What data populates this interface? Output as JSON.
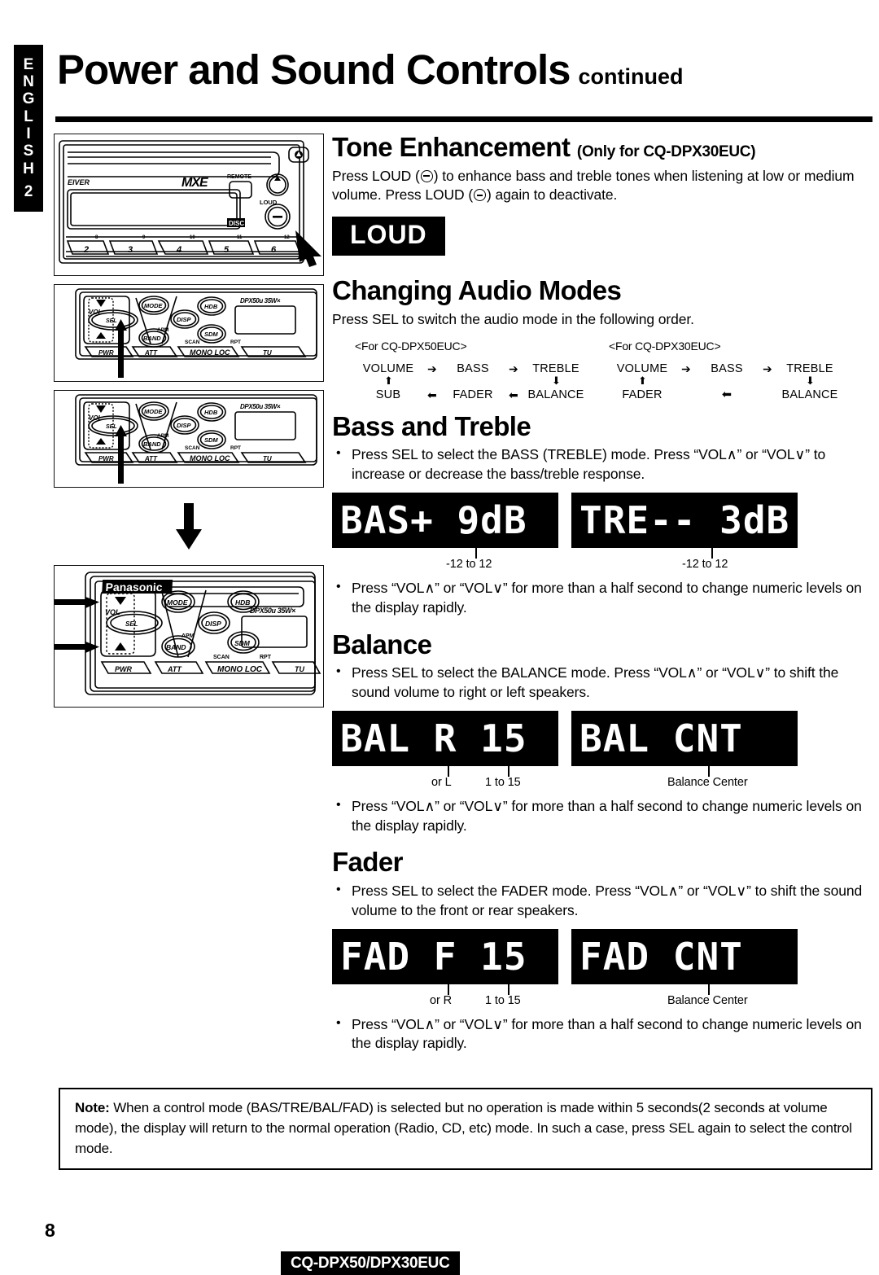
{
  "sidebar": {
    "language_letters": [
      "E",
      "N",
      "G",
      "L",
      "I",
      "S",
      "H"
    ],
    "section_number": "2"
  },
  "header": {
    "title": "Power and Sound Controls",
    "continued": "continued"
  },
  "sections": {
    "tone": {
      "heading": "Tone Enhancement",
      "qualifier": "(Only for CQ-DPX30EUC)",
      "body_part1": "Press LOUD (",
      "body_part2": ") to enhance bass and treble tones when listening at low or medium volume.  Press LOUD (",
      "body_part3": ") again to deactivate.",
      "badge_label": "LOUD"
    },
    "audio_modes": {
      "heading": "Changing Audio Modes",
      "intro": "Press SEL to switch the audio mode in the following order.",
      "groups": [
        {
          "header": "<For CQ-DPX50EUC>",
          "top_row": [
            "VOLUME",
            "BASS",
            "TREBLE"
          ],
          "bottom_row": [
            "SUB",
            "FADER",
            "BALANCE"
          ]
        },
        {
          "header": "<For CQ-DPX30EUC>",
          "top_row": [
            "VOLUME",
            "BASS",
            "TREBLE"
          ],
          "bottom_row": [
            "FADER",
            "",
            "BALANCE"
          ]
        }
      ]
    },
    "bass_treble": {
      "heading": "Bass and Treble",
      "bullet1": "Press SEL to select the BASS (TREBLE) mode.  Press “VOL∧” or “VOL∨” to increase or decrease the bass/treble response.",
      "lcd_left": "BAS+ 9dB",
      "lcd_right": "TRE-- 3dB",
      "callout_left": "-12 to 12",
      "callout_right": "-12 to 12",
      "bullet2": "Press “VOL∧” or “VOL∨” for more than a half second to change numeric levels on the display rapidly."
    },
    "balance": {
      "heading": "Balance",
      "bullet1": "Press SEL to select the BALANCE mode.  Press “VOL∧” or “VOL∨” to shift the sound volume to right or left speakers.",
      "lcd_left": "BAL  R 15",
      "lcd_right": "BAL  CNT",
      "callout_a": "or L",
      "callout_b": "1 to 15",
      "callout_c": "Balance Center",
      "bullet2": "Press “VOL∧” or “VOL∨” for more than a half second to change numeric levels on the display rapidly."
    },
    "fader": {
      "heading": "Fader",
      "bullet1": "Press SEL to select the FADER mode.  Press “VOL∧” or “VOL∨” to shift the sound volume to the front or rear speakers.",
      "lcd_left": "FAD  F 15",
      "lcd_right": "FAD  CNT",
      "callout_a": "or R",
      "callout_b": "1 to 15",
      "callout_c": "Balance Center",
      "bullet2": "Press “VOL∧” or “VOL∨” for more than a half second to change numeric levels on the display rapidly."
    }
  },
  "note": {
    "label": "Note:",
    "text": " When a control mode (BAS/TRE/BAL/FAD) is selected but no operation is made within 5 seconds(2 seconds at volume mode), the display will return to the normal operation (Radio, CD, etc) mode.  In such a case, press SEL again to select the control mode."
  },
  "illustrations": {
    "unit1": {
      "receiver_text": "EIVER",
      "logo": "MXE",
      "remote_label": "REMOTE",
      "disc_label": "DISC",
      "loud_label": "LOUD",
      "preset_numbers": [
        "2",
        "3",
        "4",
        "5",
        "6"
      ],
      "preset_small": [
        "8",
        "9",
        "10",
        "11",
        "12"
      ]
    },
    "unit_common": {
      "brand": "Panasonic",
      "vol_label": "VOL",
      "sel_label": "SEL",
      "mode_label": "MODE",
      "disp_label": "DISP",
      "hdb_label": "HDB",
      "sdm_label": "SDM",
      "band_label": "BAND",
      "apm_label": "APM",
      "pwr_label": "PWR",
      "att_label": "ATT",
      "mono_loc_label": "MONO LOC",
      "scan_label": "SCAN",
      "rpt_label": "RPT",
      "tune_label": "TU",
      "model_text": "DPX50u 35W×"
    }
  },
  "footer": {
    "page_number": "8",
    "model": "CQ-DPX50/DPX30EUC"
  }
}
